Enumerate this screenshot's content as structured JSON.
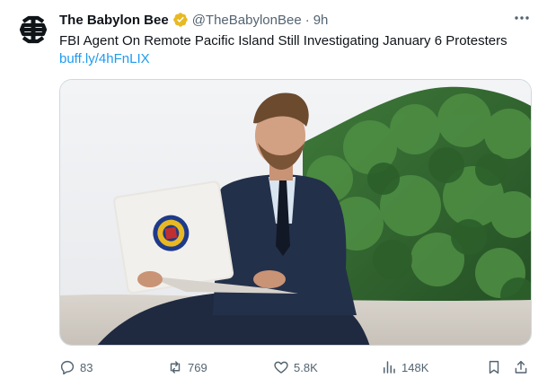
{
  "author": {
    "display_name": "The Babylon Bee",
    "handle": "@TheBabylonBee",
    "separator": "·",
    "time": "9h",
    "verified": true,
    "avatar_icon": "bee-logo-icon"
  },
  "tweet": {
    "text": "FBI Agent On Remote Pacific Island Still Investigating January 6 Protesters",
    "link": "buff.ly/4hFnLIX"
  },
  "media": {
    "description_icon": "photo-man-in-suit-with-laptop-on-beach"
  },
  "metrics": {
    "replies": "83",
    "reposts": "769",
    "likes": "5.8K",
    "views": "148K"
  },
  "colors": {
    "text": "#0f1419",
    "secondary": "#536471",
    "link": "#1d9bf0",
    "verified_badge": "#e8b923"
  }
}
